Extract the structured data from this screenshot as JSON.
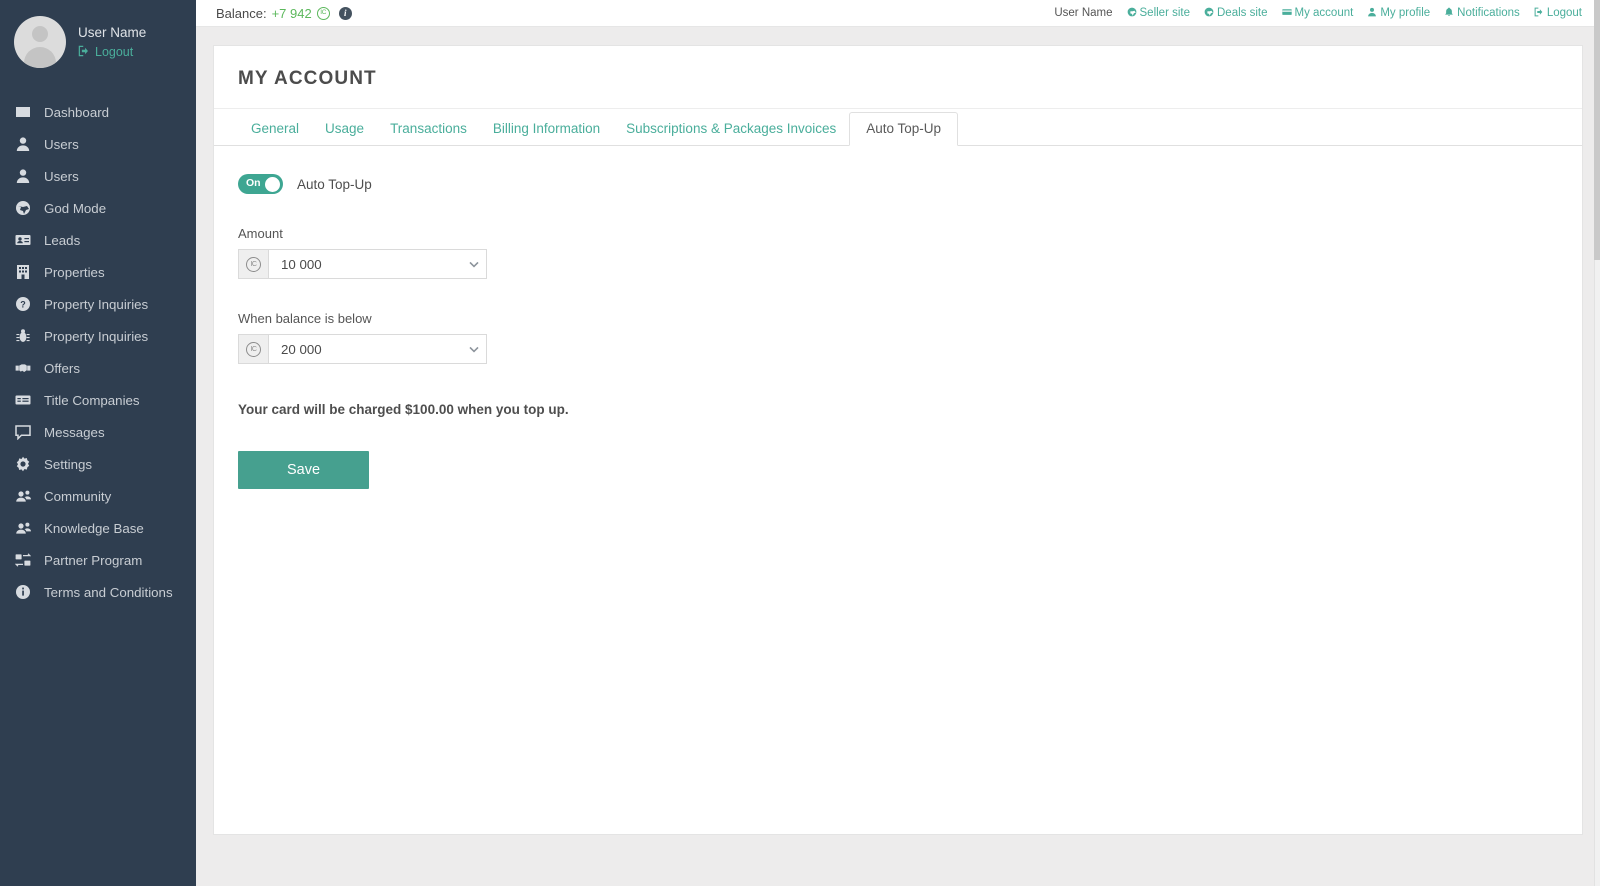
{
  "sidebar": {
    "user": {
      "name": "User Name",
      "logout_label": "Logout",
      "logout_icon": "sign-out-icon",
      "avatar_icon": "avatar-placeholder-icon"
    },
    "items": [
      {
        "label": "Dashboard",
        "icon": "chart-area-icon"
      },
      {
        "label": "Users",
        "icon": "user-icon"
      },
      {
        "label": "Users",
        "icon": "user-icon"
      },
      {
        "label": "God Mode",
        "icon": "globe-icon"
      },
      {
        "label": "Leads",
        "icon": "id-card-icon"
      },
      {
        "label": "Properties",
        "icon": "building-icon"
      },
      {
        "label": "Property Inquiries",
        "icon": "question-circle-icon"
      },
      {
        "label": "Property Inquiries",
        "icon": "bug-icon"
      },
      {
        "label": "Offers",
        "icon": "handshake-icon"
      },
      {
        "label": "Title Companies",
        "icon": "address-card-icon"
      },
      {
        "label": "Messages",
        "icon": "comment-icon"
      },
      {
        "label": "Settings",
        "icon": "gear-icon"
      },
      {
        "label": "Community",
        "icon": "users-group-icon"
      },
      {
        "label": "Knowledge Base",
        "icon": "users-group-icon"
      },
      {
        "label": "Partner Program",
        "icon": "partner-exchange-icon"
      },
      {
        "label": "Terms and Conditions",
        "icon": "info-circle-icon"
      }
    ]
  },
  "topbar": {
    "balance_label": "Balance:",
    "balance_value": "+7 942",
    "balance_coin_icon": "ic-coin-icon",
    "balance_info_icon": "info-icon",
    "user_name": "User Name",
    "links": [
      {
        "label": "Seller site",
        "icon": "globe-icon"
      },
      {
        "label": "Deals site",
        "icon": "globe-icon"
      },
      {
        "label": "My account",
        "icon": "card-icon"
      },
      {
        "label": "My profile",
        "icon": "user-icon"
      },
      {
        "label": "Notifications",
        "icon": "bell-icon"
      },
      {
        "label": "Logout",
        "icon": "sign-out-icon"
      }
    ]
  },
  "main": {
    "page_title": "MY ACCOUNT",
    "tabs": [
      {
        "label": "General",
        "active": false
      },
      {
        "label": "Usage",
        "active": false
      },
      {
        "label": "Transactions",
        "active": false
      },
      {
        "label": "Billing Information",
        "active": false
      },
      {
        "label": "Subscriptions & Packages Invoices",
        "active": false
      },
      {
        "label": "Auto Top-Up",
        "active": true
      }
    ],
    "auto_topup": {
      "toggle_state": "On",
      "toggle_label": "Auto Top-Up",
      "amount": {
        "label": "Amount",
        "value": "10 000",
        "currency_icon": "ic-coin-icon",
        "caret_icon": "chevron-down-icon"
      },
      "threshold": {
        "label": "When balance is below",
        "value": "20 000",
        "currency_icon": "ic-coin-icon",
        "caret_icon": "chevron-down-icon"
      },
      "charge_note": "Your card will be charged $100.00 when you top up.",
      "save_label": "Save"
    }
  },
  "colors": {
    "sidebar_bg": "#2f3e50",
    "accent_teal": "#4aae9b",
    "save_button": "#46a08f",
    "balance_green": "#5cb85c",
    "page_bg": "#edecec"
  }
}
